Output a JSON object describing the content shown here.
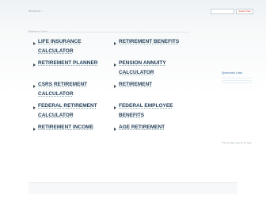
{
  "header": {
    "site_name": "lifeinsur...",
    "search_placeholder": "",
    "search_button": "Search Ads"
  },
  "main": {
    "related_label": "Related Links",
    "links": [
      {
        "label_line1": "LIFE INSURANCE",
        "label_line2": "CALCULATOR"
      },
      {
        "label_line1": "RETIREMENT BENEFITS",
        "label_line2": ""
      },
      {
        "label_line1": "RETIREMENT PLANNER",
        "label_line2": ""
      },
      {
        "label_line1": "PENSION ANNUITY",
        "label_line2": "CALCULATOR"
      },
      {
        "label_line1": "CSRS RETIREMENT",
        "label_line2": "CALCULATOR"
      },
      {
        "label_line1": "RETIREMENT",
        "label_line2": ""
      },
      {
        "label_line1": "FEDERAL RETIREMENT",
        "label_line2": "CALCULATOR"
      },
      {
        "label_line1": "FEDERAL EMPLOYEE",
        "label_line2": "BENEFITS"
      },
      {
        "label_line1": "RETIREMENT INCOME",
        "label_line2": ""
      },
      {
        "label_line1": "AGE RETIREMENT",
        "label_line2": ""
      }
    ]
  },
  "sidebar": {
    "title": "Sponsored Links",
    "note": "This domain may be for sale"
  },
  "footer": {
    "text": "",
    "copyright": ""
  },
  "colors": {
    "link": "#1f3b55",
    "accent": "#d04a2a",
    "muted": "#9aa7b0"
  }
}
